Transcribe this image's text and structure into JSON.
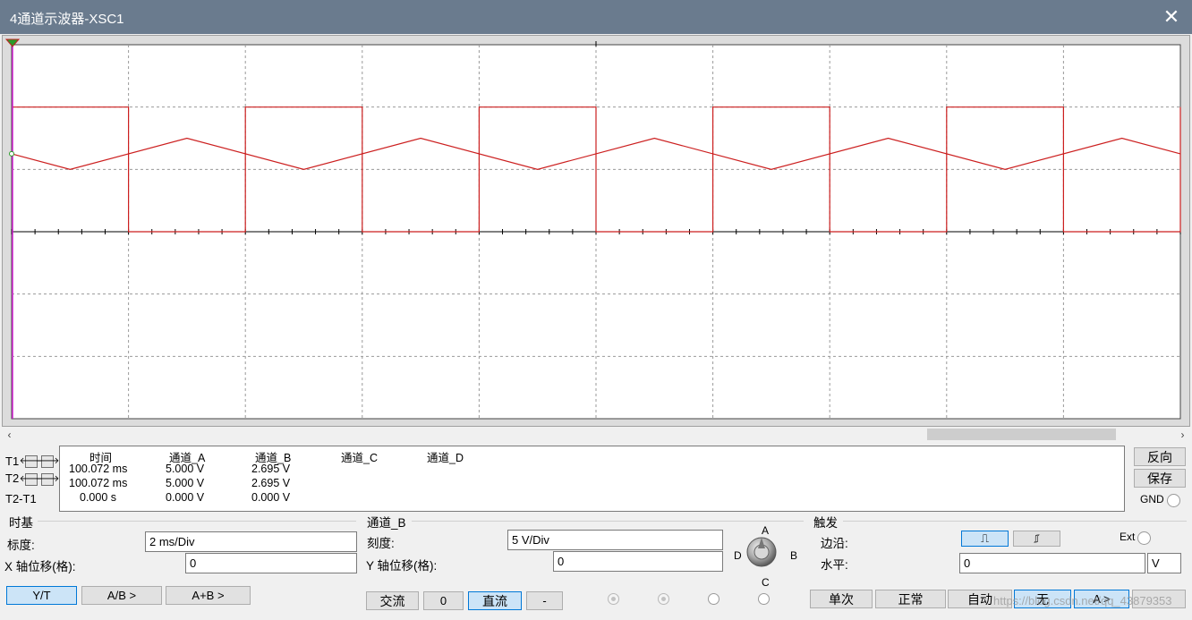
{
  "window": {
    "title": "4通道示波器-XSC1",
    "close_glyph": "✕"
  },
  "scope": {
    "background": "#ffffff",
    "grid_color": "#9a9a9a",
    "trace_color": "#cc1f1f",
    "cursor1_color": "#d020d0",
    "grid_cols": 10,
    "grid_rows": 6,
    "square_wave": {
      "high_div": 2,
      "low_div": 0,
      "period_ms": 4,
      "duty": 0.5
    },
    "triangle_wave": {
      "high_div": 1.5,
      "low_div": 1,
      "period_ms": 4
    },
    "timebase_ms_per_div": 2
  },
  "scrollbar": {
    "left_arrow": "‹",
    "right_arrow": "›",
    "position": 0.78
  },
  "cursors": {
    "t1_label": "T1",
    "t2_label": "T2",
    "dt_label": "T2-T1",
    "arrow_left": "🡐",
    "arrow_right": "🡒",
    "headers": [
      "时间",
      "通道_A",
      "通道_B",
      "通道_C",
      "通道_D"
    ],
    "rows": [
      [
        "100.072 ms",
        "5.000 V",
        "2.695 V",
        "",
        ""
      ],
      [
        "100.072 ms",
        "5.000 V",
        "2.695 V",
        "",
        ""
      ],
      [
        "0.000 s",
        "0.000 V",
        "0.000 V",
        "",
        ""
      ]
    ]
  },
  "side_buttons": {
    "reverse": "反向",
    "save": "保存",
    "gnd": "GND"
  },
  "timebase": {
    "title": "时基",
    "scale_label": "标度:",
    "scale_value": "2 ms/Div",
    "xpos_label": "X 轴位移(格):",
    "xpos_value": "0",
    "modes": [
      "Y/T",
      "A/B >",
      "A+B >"
    ],
    "active_mode": "Y/T"
  },
  "channel": {
    "title": "通道_B",
    "scale_label": "刻度:",
    "scale_value": "5  V/Div",
    "ypos_label": "Y 轴位移(格):",
    "ypos_value": "0",
    "coupling": [
      "交流",
      "0",
      "直流",
      "-"
    ],
    "active_coupling": "直流",
    "knob_labels": {
      "a": "A",
      "b": "B",
      "c": "C",
      "d": "D"
    }
  },
  "trigger": {
    "title": "触发",
    "edge_label": "边沿:",
    "rise_glyph": "⎍",
    "fall_glyph": "⎎",
    "ext_label": "Ext",
    "level_label": "水平:",
    "level_value": "0",
    "level_unit": "V",
    "modes": [
      "单次",
      "正常",
      "自动",
      "无",
      "A >"
    ],
    "active_modes": [
      "无",
      "A >"
    ]
  },
  "watermark": "https://blog.csdn.net/qq_43879353"
}
